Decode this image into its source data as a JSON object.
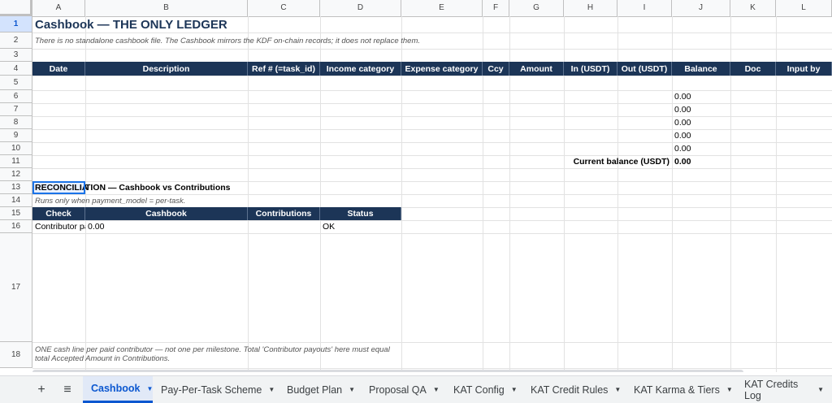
{
  "columns": [
    "A",
    "B",
    "C",
    "D",
    "E",
    "F",
    "G",
    "H",
    "I",
    "J",
    "K",
    "L"
  ],
  "rows": [
    "1",
    "2",
    "3",
    "4",
    "5",
    "6",
    "7",
    "8",
    "9",
    "10",
    "11",
    "12",
    "13",
    "14",
    "15",
    "16",
    "17",
    "18"
  ],
  "sheet": {
    "title": "Cashbook — THE ONLY LEDGER",
    "subtitle": "There is no standalone cashbook file. The Cashbook mirrors the KDF on-chain records; it does not replace them.",
    "ledger_headers": [
      "Date",
      "Description",
      "Ref # (=task_id)",
      "Income category",
      "Expense category",
      "Ccy",
      "Amount",
      "In (USDT)",
      "Out (USDT)",
      "Balance",
      "Doc",
      "Input by"
    ],
    "balances": [
      "0.00",
      "0.00",
      "0.00",
      "0.00",
      "0.00"
    ],
    "current_balance_label": "Current balance (USDT)",
    "current_balance_value": "0.00",
    "reconciliation": {
      "title_highlight": "RECONCILIA",
      "title_rest": "TION — Cashbook vs Contributions",
      "note": "Runs only when payment_model = per-task.",
      "headers": [
        "Check",
        "Cashbook",
        "Contributions",
        "Status"
      ],
      "row": {
        "check": "Contributor payouts",
        "cashbook": "0.00",
        "contributions": "",
        "status": "OK"
      }
    },
    "footer_note": "ONE cash line per paid contributor — not one per milestone. Total 'Contributor payouts' here must equal total Accepted Amount in Contributions."
  },
  "tabs": {
    "add_icon": "+",
    "menu_icon": "≡",
    "items": [
      "Cashbook",
      "Pay-Per-Task Scheme",
      "Budget Plan",
      "Proposal QA",
      "KAT Config",
      "KAT Credit Rules",
      "KAT Karma & Tiers",
      "KAT Credits Log"
    ],
    "active_index": 0
  }
}
